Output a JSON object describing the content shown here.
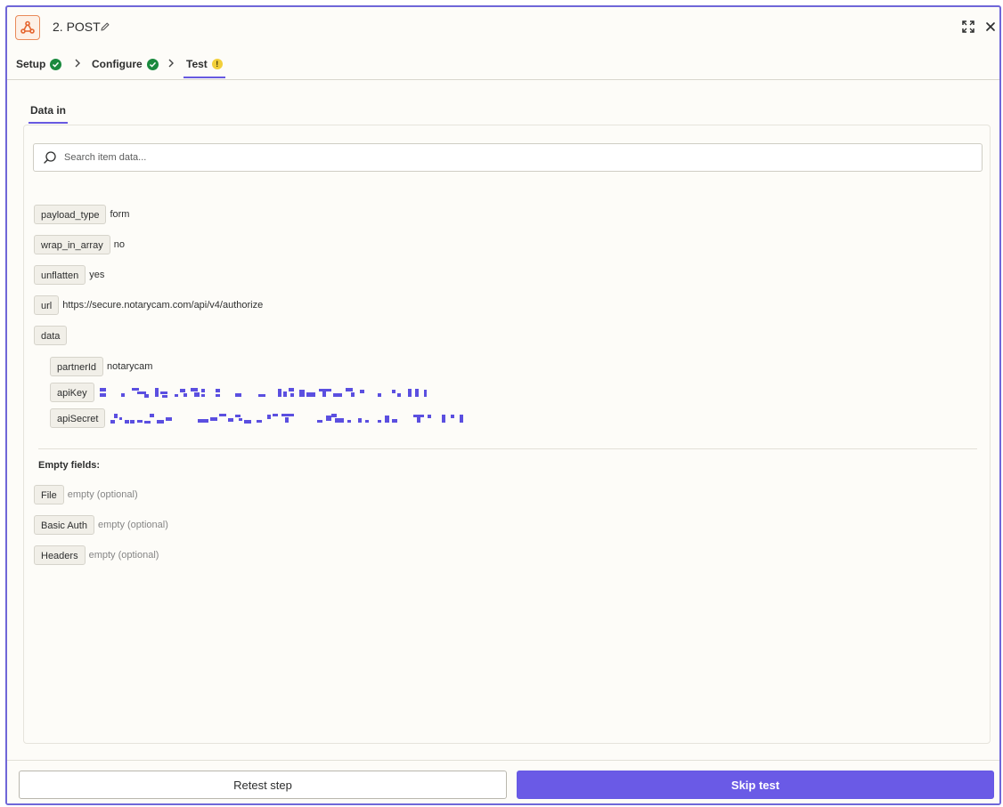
{
  "header": {
    "title": "2. POST",
    "app_icon": "webhook-icon",
    "actions": [
      "expand-icon",
      "close-icon"
    ]
  },
  "stepper": {
    "steps": [
      {
        "label": "Setup",
        "status": "complete"
      },
      {
        "label": "Configure",
        "status": "complete"
      },
      {
        "label": "Test",
        "status": "warning"
      }
    ]
  },
  "tabs": [
    {
      "label": "Data in",
      "active": true
    }
  ],
  "search": {
    "placeholder": "Search item data...",
    "value": ""
  },
  "fields": [
    {
      "key": "payload_type",
      "value": "form"
    },
    {
      "key": "wrap_in_array",
      "value": "no"
    },
    {
      "key": "unflatten",
      "value": "yes"
    },
    {
      "key": "url",
      "value": "https://secure.notarycam.com/api/v4/authorize"
    },
    {
      "key": "data",
      "value": ""
    }
  ],
  "data_fields": [
    {
      "key": "partnerId",
      "value": "notarycam"
    },
    {
      "key": "apiKey",
      "value": "",
      "redacted": true
    },
    {
      "key": "apiSecret",
      "value": "",
      "redacted": true
    }
  ],
  "empty_fields": {
    "label": "Empty fields:",
    "items": [
      {
        "key": "File",
        "value": "empty (optional)"
      },
      {
        "key": "Basic Auth",
        "value": "empty (optional)"
      },
      {
        "key": "Headers",
        "value": "empty (optional)"
      }
    ]
  },
  "footer": {
    "retest_label": "Retest step",
    "skip_label": "Skip test"
  },
  "colors": {
    "accent": "#6a5ae6",
    "success": "#1a8a3e",
    "warning": "#f2cf3a",
    "panel_border": "#6f66d8",
    "redaction": "#5b4fe0"
  }
}
